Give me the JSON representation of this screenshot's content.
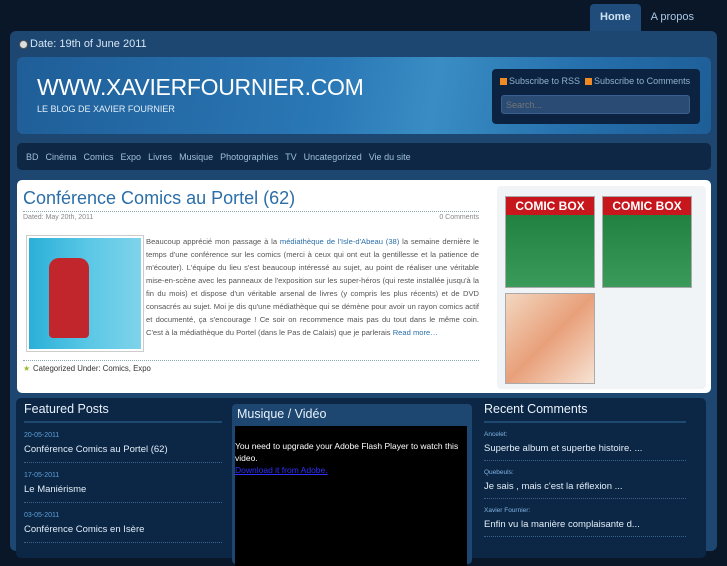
{
  "nav": {
    "tabs": [
      {
        "label": "Home",
        "active": true
      },
      {
        "label": "A propos",
        "active": false
      }
    ]
  },
  "date": "Date: 19th of June 2011",
  "header": {
    "title": "WWW.XAVIERFOURNIER.COM",
    "subtitle": "LE BLOG DE XAVIER FOURNIER",
    "rss": "Subscribe to RSS",
    "comments_rss": "Subscribe to Comments",
    "search_placeholder": "Search..."
  },
  "categories": [
    "BD",
    "Cinéma",
    "Comics",
    "Expo",
    "Livres",
    "Musique",
    "Photographies",
    "TV",
    "Uncategorized",
    "Vie du site"
  ],
  "post": {
    "title": "Conférence Comics au Portel (62)",
    "dated": "Dated: May 20th, 2011",
    "comments": "0 Comments",
    "text_before": "Beaucoup apprécié mon passage à la ",
    "link": "médiathèque de l'Isle-d'Abeau (38)",
    "text_after": " la semaine dernière le temps d'une conférence sur les comics (merci à ceux qui ont eut la gentillesse et la patience de m'écouter). L'équipe du lieu s'est beaucoup intéressé au sujet, au point de réaliser une véritable mise-en-scène avec les panneaux de l'exposition sur les super-héros (qui reste installée jusqu'à la fin du mois) et dispose d'un véritable arsenal de livres (y compris les plus récents) et de DVD consacrés au sujet. Moi je dis qu'une médiathèque qui se démène pour avoir un rayon comics actif et documenté, ça s'encourage ! Ce soir on recommence mais pas du tout dans le même coin. C'est à la médiathèque du Portel (dans le Pas de Calais) que je parlerais ",
    "read_more": "Read more…",
    "categorized": "Categorized Under: Comics, Expo"
  },
  "sidebar": {
    "covers": [
      "COMIC BOX",
      "COMIC BOX"
    ]
  },
  "featured": {
    "title": "Featured Posts",
    "items": [
      {
        "date": "20-05-2011",
        "title": "Conférence Comics au Portel (62)"
      },
      {
        "date": "17-05-2011",
        "title": "Le Maniérisme"
      },
      {
        "date": "03-05-2011",
        "title": "Conférence Comics en Isère"
      }
    ]
  },
  "video": {
    "title": "Musique / Vidéo",
    "message": "You need to upgrade your Adobe Flash Player to watch this video.",
    "link": "Download it from Adobe."
  },
  "recent": {
    "title": "Recent Comments",
    "items": [
      {
        "author": "Ancelet:",
        "text": "Superbe album et superbe histoire. ..."
      },
      {
        "author": "Quebeuls:",
        "text": "Je sais , mais c'est la réflexion ..."
      },
      {
        "author": "Xavier Fournier:",
        "text": "Enfin vu la manière complaisante d..."
      }
    ]
  }
}
